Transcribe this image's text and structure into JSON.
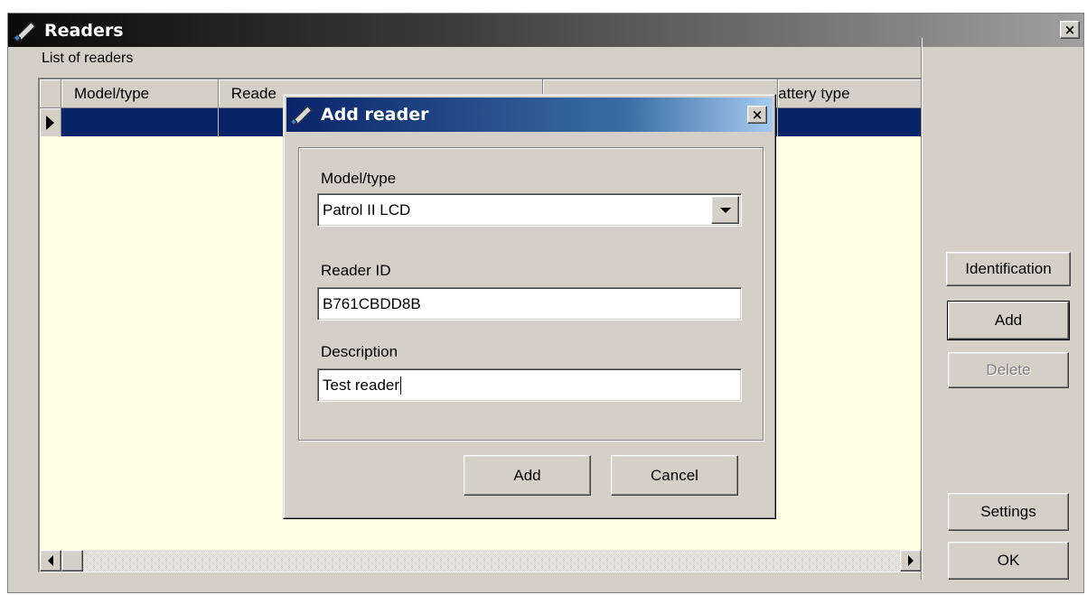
{
  "main_window": {
    "title": "Readers",
    "close_glyph": "×",
    "list_label": "List of readers",
    "columns": [
      "Model/type",
      "Reade",
      "attery type"
    ],
    "selected_row_color": "#0a246a",
    "grid_background": "#ffffe6",
    "buttons": {
      "identification": "Identification",
      "add": "Add",
      "delete": "Delete",
      "settings": "Settings",
      "ok": "OK"
    }
  },
  "dialog": {
    "title": "Add reader",
    "close_glyph": "×",
    "model_label": "Model/type",
    "model_value": "Patrol II LCD",
    "reader_id_label": "Reader ID",
    "reader_id_value": "B761CBDD8B",
    "description_label": "Description",
    "description_value": "Test reader",
    "add_label": "Add",
    "cancel_label": "Cancel"
  },
  "icons": {
    "window_icon": "pencil-icon",
    "close": "close-icon",
    "dropdown": "chevron-down-icon",
    "scroll_left": "arrow-left-icon",
    "scroll_right": "arrow-right-icon",
    "row_indicator": "triangle-right-icon"
  }
}
